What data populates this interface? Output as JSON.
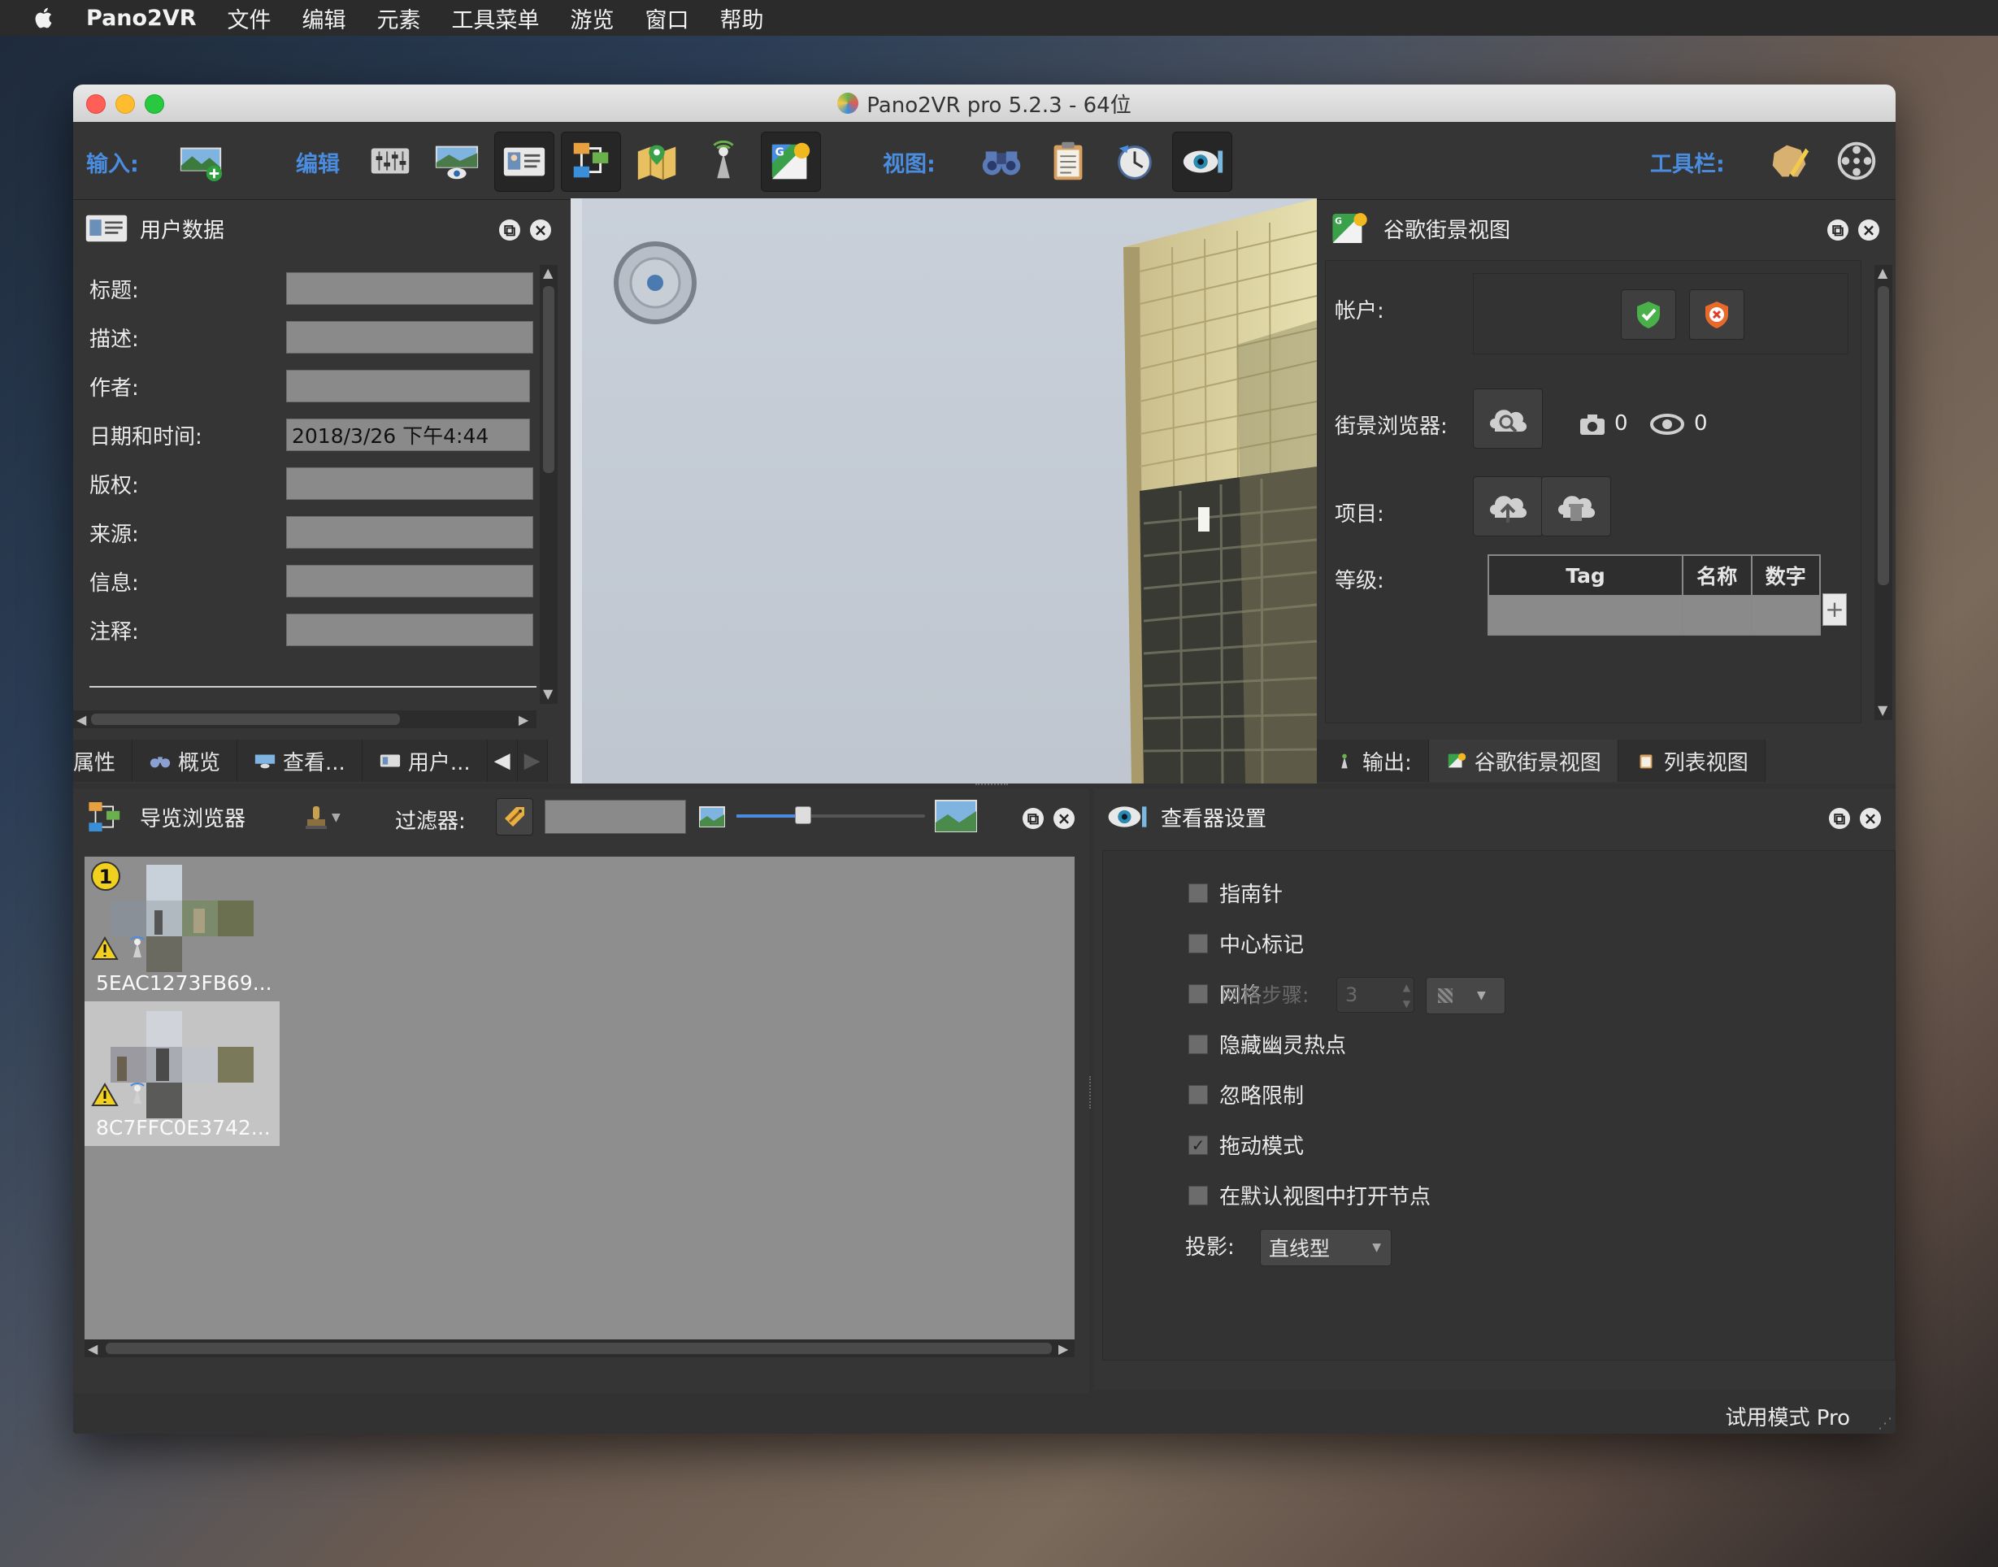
{
  "menubar": {
    "app": "Pano2VR",
    "items": [
      "文件",
      "编辑",
      "元素",
      "工具菜单",
      "游览",
      "窗口",
      "帮助"
    ]
  },
  "window": {
    "title": "Pano2VR pro 5.2.3 - 64位"
  },
  "toolbar": {
    "input_label": "输入:",
    "edit_label": "编辑",
    "view_label": "视图:",
    "toolbar_label": "工具栏:"
  },
  "user_data": {
    "title": "用户数据",
    "fields": [
      {
        "label": "标题:",
        "value": ""
      },
      {
        "label": "描述:",
        "value": ""
      },
      {
        "label": "作者:",
        "value": ""
      },
      {
        "label": "日期和时间:",
        "value": "2018/3/26 下午4:44"
      },
      {
        "label": "版权:",
        "value": ""
      },
      {
        "label": "来源:",
        "value": ""
      },
      {
        "label": "信息:",
        "value": ""
      },
      {
        "label": "注释:",
        "value": ""
      }
    ],
    "tabs": [
      "属性",
      "概览",
      "查看...",
      "用户..."
    ]
  },
  "street_view": {
    "title": "谷歌街景视图",
    "account_label": "帐户:",
    "browser_label": "街景浏览器:",
    "photo_count": "0",
    "view_count": "0",
    "project_label": "项目:",
    "level_label": "等级:",
    "table_headers": [
      "Tag",
      "名称",
      "数字"
    ],
    "tabs": [
      "输出:",
      "谷歌街景视图",
      "列表视图"
    ]
  },
  "tour_browser": {
    "title": "导览浏览器",
    "filter_label": "过滤器:",
    "filter_value": "",
    "nodes": [
      {
        "badge": "1",
        "label": "5EAC1273FB69..."
      },
      {
        "badge": "",
        "label": "8C7FFC0E3742..."
      }
    ]
  },
  "viewer_settings": {
    "title": "查看器设置",
    "options": [
      {
        "label": "指南针",
        "checked": false
      },
      {
        "label": "中心标记",
        "checked": false
      },
      {
        "label": "网格",
        "checked": false
      },
      {
        "label": "隐藏幽灵热点",
        "checked": false
      },
      {
        "label": "忽略限制",
        "checked": false
      },
      {
        "label": "拖动模式",
        "checked": true
      },
      {
        "label": "在默认视图中打开节点",
        "checked": false
      }
    ],
    "grid_step_label": "网格步骤:",
    "grid_step_value": "3",
    "projection_label": "投影:",
    "projection_value": "直线型",
    "checkmark": "✓"
  },
  "status": {
    "text": "试用模式 Pro"
  },
  "colors": {
    "accent": "#4a8de0",
    "close": "#ff5f57",
    "minimize": "#febc2e",
    "zoom": "#28c840"
  }
}
